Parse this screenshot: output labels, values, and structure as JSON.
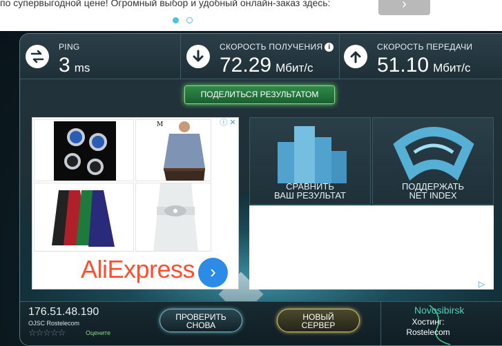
{
  "promo": {
    "text": "по супервыгодной цене! Огромный выбор и удобный онлайн-заказ здесь:",
    "next_label": "›"
  },
  "metrics": {
    "ping": {
      "label": "PING",
      "value": "3",
      "unit": "ms"
    },
    "download": {
      "label": "СКОРОСТЬ ПОЛУЧЕНИЯ",
      "value": "72.29",
      "unit": "Мбит/с",
      "info": "i"
    },
    "upload": {
      "label": "СКОРОСТЬ ПЕРЕДАЧИ",
      "value": "51.10",
      "unit": "Мбит/с"
    }
  },
  "share_label": "ПОДЕЛИТЬСЯ РЕЗУЛЬТАТОМ",
  "ad": {
    "brand_text": "AliExpress",
    "info_label": "ⓘ ✕",
    "go_label": "›",
    "shirt_brand": "M"
  },
  "tiles": {
    "compare": {
      "line1": "СРАВНИТЬ",
      "line2": "ВАШ РЕЗУЛЬТАТ"
    },
    "support": {
      "line1": "ПОДДЕРЖАТЬ",
      "line2": "NET INDEX"
    }
  },
  "ad_mark": "▷",
  "bottom": {
    "ip": "176.51.48.190",
    "isp": "OJSC Rostelecom",
    "stars": "☆☆☆☆☆",
    "rate_label": "Оцените",
    "retest": {
      "line1": "ПРОВЕРИТЬ",
      "line2": "СНОВА"
    },
    "new_server": {
      "line1": "НОВЫЙ",
      "line2": "СЕРВЕР"
    },
    "city": "Novosibirsk",
    "host_label": "Хостинг:",
    "host_name": "Rostelecom"
  },
  "colors": {
    "accent_green": "#6fdc6a",
    "accent_gold": "#d6c46a",
    "brand_ali": "#ff4d2e"
  },
  "icons": {
    "ping": "exchange-arrows-icon",
    "download": "arrow-down-icon",
    "upload": "arrow-up-icon"
  }
}
